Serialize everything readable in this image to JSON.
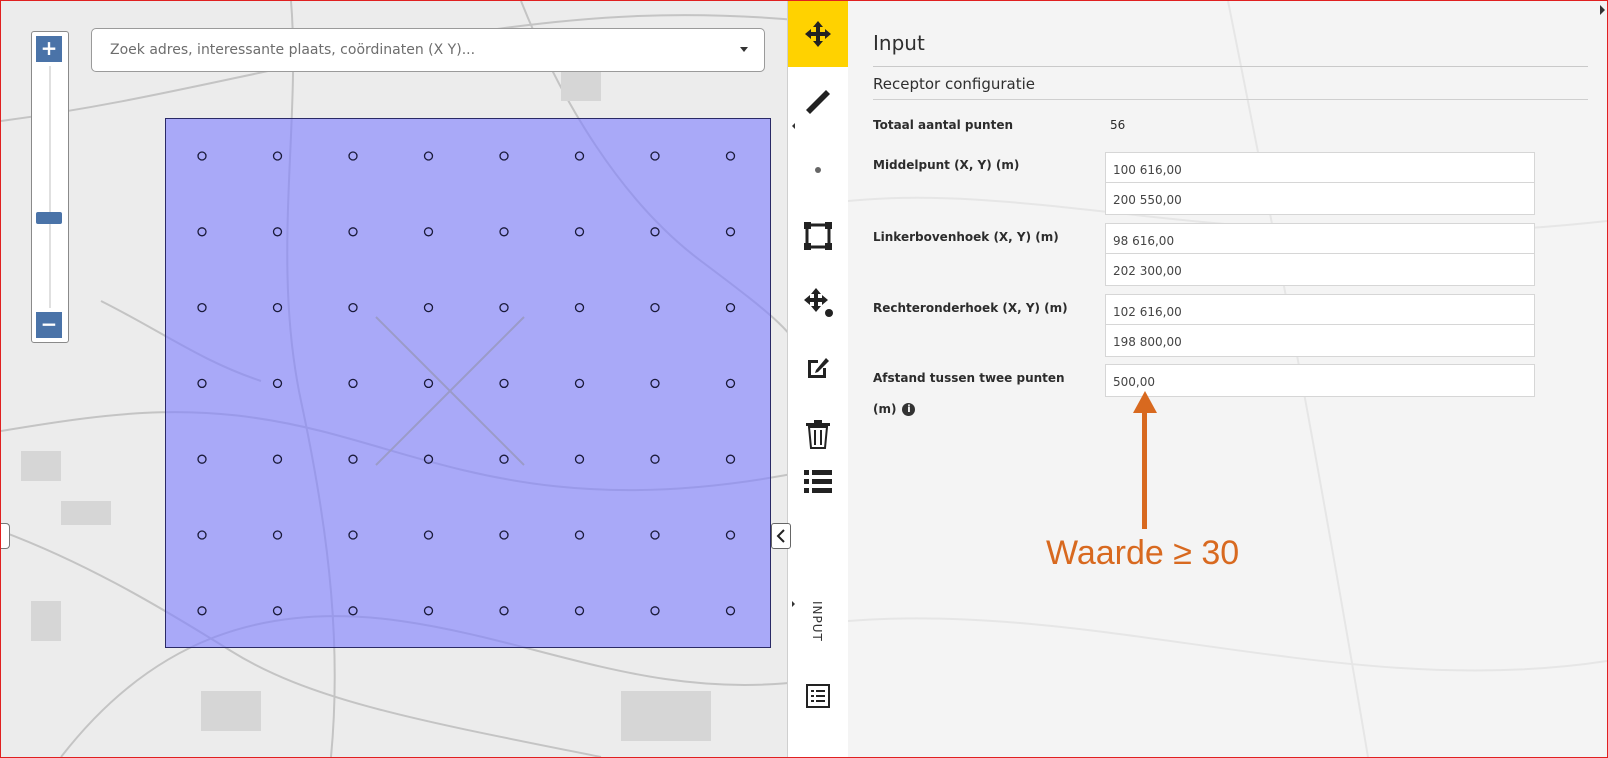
{
  "search": {
    "placeholder": "Zoek adres, interessante plaats, coördinaten (X Y)..."
  },
  "map": {
    "zoom_in": "+",
    "zoom_out": "−",
    "zoom_level": 0.4,
    "grid": {
      "columns": 8,
      "rows": 7,
      "point_glyph": "o"
    }
  },
  "toolbar": {
    "tools": [
      "move-icon",
      "ruler-icon",
      "point-icon",
      "rectangle-icon",
      "move-point-icon",
      "edit-icon",
      "trash-icon",
      "list-icon"
    ],
    "collapse": "<",
    "vertical_tab": "INPUT",
    "accent": "#ffd200"
  },
  "panel": {
    "title": "Input",
    "section": "Receptor configuratie",
    "total_label": "Totaal aantal punten",
    "total_value": "56",
    "center_label": "Middelpunt (X, Y) (m)",
    "center_x": "100 616,00",
    "center_y": "200 550,00",
    "top_left_label": "Linkerbovenhoek (X, Y) (m)",
    "top_left_x": "98 616,00",
    "top_left_y": "202 300,00",
    "bottom_right_label": "Rechteronderhoek (X, Y) (m)",
    "bottom_right_x": "102 616,00",
    "bottom_right_y": "198 800,00",
    "distance_label_1": "Afstand tussen twee punten",
    "distance_label_2": "(m)",
    "distance_value": "500,00"
  },
  "annotation": {
    "text": "Waarde ≥ 30",
    "color": "#d8691f"
  },
  "colors": {
    "grid_fill": "#8080ff",
    "zoom_buttons": "#4a73a8"
  }
}
